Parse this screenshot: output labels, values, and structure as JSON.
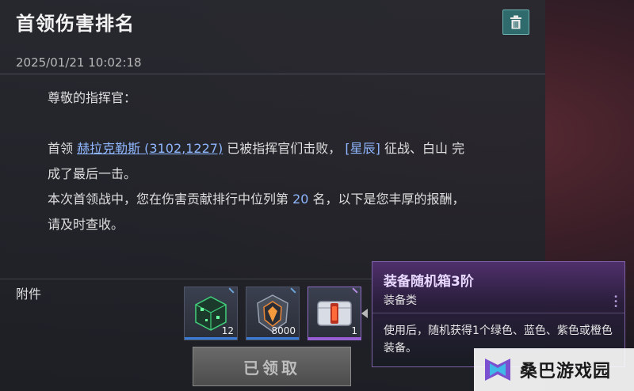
{
  "mail": {
    "title": "首领伤害排名",
    "timestamp": "2025/01/21  10:02:18",
    "greeting": "尊敬的指挥官：",
    "line1_prefix": "首领 ",
    "boss_link": "赫拉克勒斯 (3102,1227)",
    "line1_mid": " 已被指挥官们击败， ",
    "alliance_tag": "[星辰]",
    "line1_suffix": " 征战、白山 完",
    "line2": "成了最后一击。",
    "line3_prefix": "本次首领战中，您在伤害贡献排行中位列第 ",
    "rank": "20",
    "line3_suffix": " 名，以下是您丰厚的报酬，",
    "line4": "请及时查收。"
  },
  "attachments": {
    "label": "附件",
    "items": [
      {
        "name": "green-cube-item",
        "count": "12",
        "bar_color": "#3a7bd5"
      },
      {
        "name": "emblem-item",
        "count": "8000",
        "bar_color": "#3a7bd5"
      },
      {
        "name": "equipment-box-item",
        "count": "1",
        "bar_color": "#9a5bd6"
      }
    ],
    "claimed_label": "已领取"
  },
  "tooltip": {
    "name": "装备随机箱3阶",
    "type": "装备类",
    "description": "使用后，随机获得1个绿色、蓝色、紫色或橙色装备。"
  },
  "watermark": {
    "text": "桑巴游戏园"
  },
  "colors": {
    "accent_teal": "#2f6b6d",
    "link_blue": "#8fb7ff",
    "tooltip_purple": "#7d62a8"
  }
}
